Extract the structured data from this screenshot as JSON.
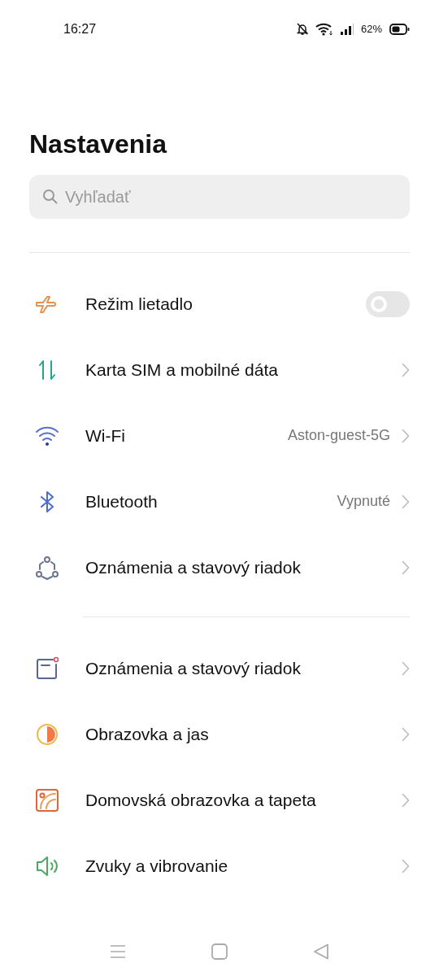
{
  "status_bar": {
    "time": "16:27",
    "battery": "62%"
  },
  "title": "Nastavenia",
  "search": {
    "placeholder": "Vyhľadať"
  },
  "groups": [
    {
      "items": [
        {
          "kind": "toggle",
          "label": "Režim lietadlo",
          "on": false
        },
        {
          "kind": "link",
          "label": "Karta SIM a mobilné dáta"
        },
        {
          "kind": "link",
          "label": "Wi-Fi",
          "value": "Aston-guest-5G"
        },
        {
          "kind": "link",
          "label": "Bluetooth",
          "value": "Vypnuté"
        },
        {
          "kind": "link",
          "label": "Oznámenia a stavový riadok"
        }
      ]
    },
    {
      "items": [
        {
          "kind": "link",
          "label": "Oznámenia a stavový riadok"
        },
        {
          "kind": "link",
          "label": "Obrazovka a jas"
        },
        {
          "kind": "link",
          "label": "Domovská obrazovka a tapeta"
        },
        {
          "kind": "link",
          "label": "Zvuky a vibrovanie"
        }
      ]
    }
  ]
}
